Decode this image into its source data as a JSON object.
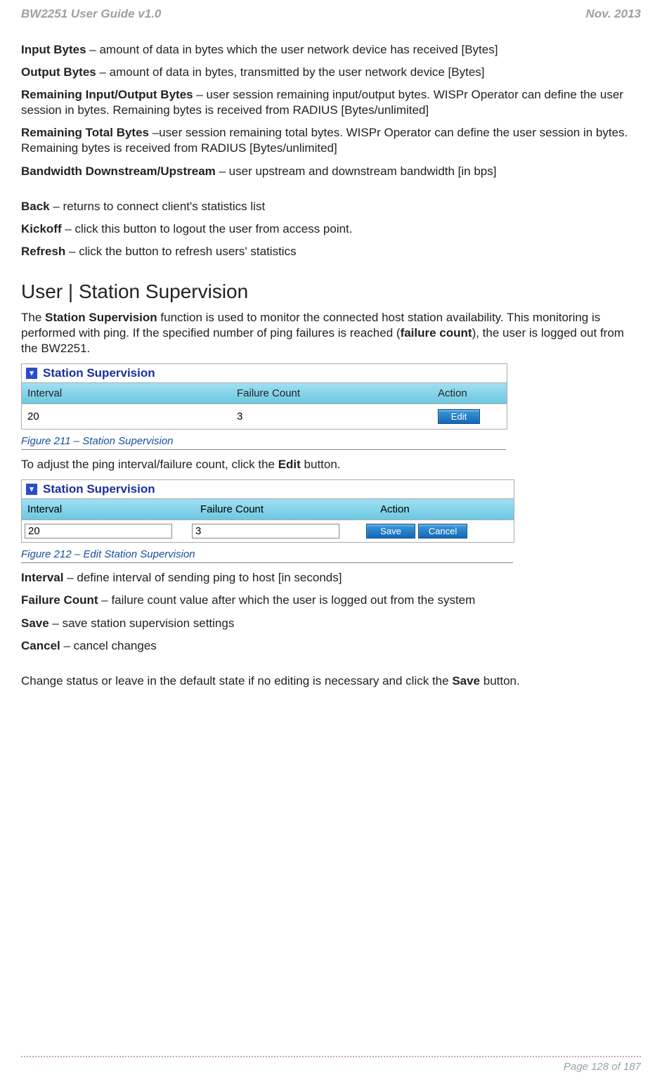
{
  "header": {
    "left": "BW2251 User Guide v1.0",
    "right": "Nov.  2013"
  },
  "defs": {
    "inputBytes": {
      "term": "Input Bytes",
      "desc": " – amount of data in bytes which the user network device has received [Bytes]"
    },
    "outputBytes": {
      "term": "Output Bytes",
      "desc": " – amount of data in bytes, transmitted by the user network device [Bytes]"
    },
    "remIO": {
      "term": "Remaining Input/Output Bytes",
      "desc": " – user session remaining input/output bytes. WISPr Operator can define the user session in bytes. Remaining bytes is received from RADIUS [Bytes/unlimited]"
    },
    "remTotal": {
      "term": "Remaining Total Bytes",
      "desc": " –user session remaining total bytes. WISPr Operator can define the user session in bytes. Remaining bytes is received from RADIUS [Bytes/unlimited]"
    },
    "bw": {
      "term": "Bandwidth Downstream/Upstream",
      "desc": " – user upstream and downstream bandwidth [in bps]"
    },
    "back": {
      "term": "Back",
      "desc": " – returns to connect client's statistics list"
    },
    "kickoff": {
      "term": "Kickoff",
      "desc": " – click this button to logout the user from access point."
    },
    "refresh": {
      "term": "Refresh",
      "desc": " – click the button to refresh users' statistics"
    }
  },
  "section": {
    "title": "User | Station Supervision",
    "intro1": "The ",
    "introBold1": "Station Supervision",
    "intro2": " function is used to monitor the connected host station availability. This monitoring is performed with ping. If the specified number of ping failures is reached (",
    "introBold2": "failure count",
    "intro3": "), the user is logged out from the BW2251."
  },
  "table1": {
    "title": "Station Supervision",
    "h1": "Interval",
    "h2": "Failure Count",
    "h3": "Action",
    "v1": "20",
    "v2": "3",
    "btn": "Edit"
  },
  "fig1": "Figure 211 – Station Supervision",
  "adjust": {
    "pre": "To adjust the ping interval/failure count, click the ",
    "bold": "Edit",
    "post": " button."
  },
  "table2": {
    "title": "Station Supervision",
    "h1": "Interval",
    "h2": "Failure Count",
    "h3": "Action",
    "v1": "20",
    "v2": "3",
    "btnSave": "Save",
    "btnCancel": "Cancel"
  },
  "fig2": "Figure 212 – Edit Station Supervision",
  "defs2": {
    "interval": {
      "term": "Interval",
      "desc": " – define interval of sending ping to host [in seconds]"
    },
    "fc": {
      "term": "Failure Count",
      "desc": " – failure count value after which the user is logged out from the system"
    },
    "save": {
      "term": "Save",
      "desc": " – save station supervision settings"
    },
    "cancel": {
      "term": "Cancel",
      "desc": " – cancel changes"
    }
  },
  "change": {
    "pre": "Change status or leave in the default state if no editing is necessary and click the ",
    "bold": "Save",
    "post": " button."
  },
  "footer": {
    "page": "Page 128 of 187"
  }
}
